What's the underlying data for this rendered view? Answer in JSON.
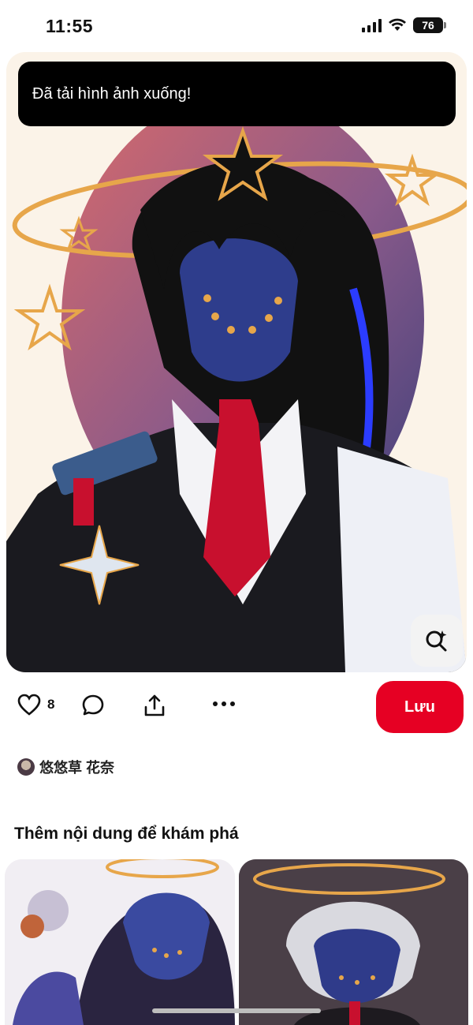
{
  "status_bar": {
    "time": "11:55",
    "battery_level": "76"
  },
  "toast": {
    "message": "Đã tải hình ảnh xuống!"
  },
  "pin": {
    "like_count": "8",
    "save_label": "Lưu"
  },
  "creator": {
    "name": "悠悠草 花奈"
  },
  "more_section": {
    "title": "Thêm nội dung để khám phá"
  },
  "icons": {
    "like": "heart-icon",
    "comment": "comment-icon",
    "share": "share-icon",
    "more": "more-icon",
    "lens": "visual-search-icon"
  },
  "colors": {
    "save_button": "#e60023",
    "toast_bg": "#000000"
  }
}
